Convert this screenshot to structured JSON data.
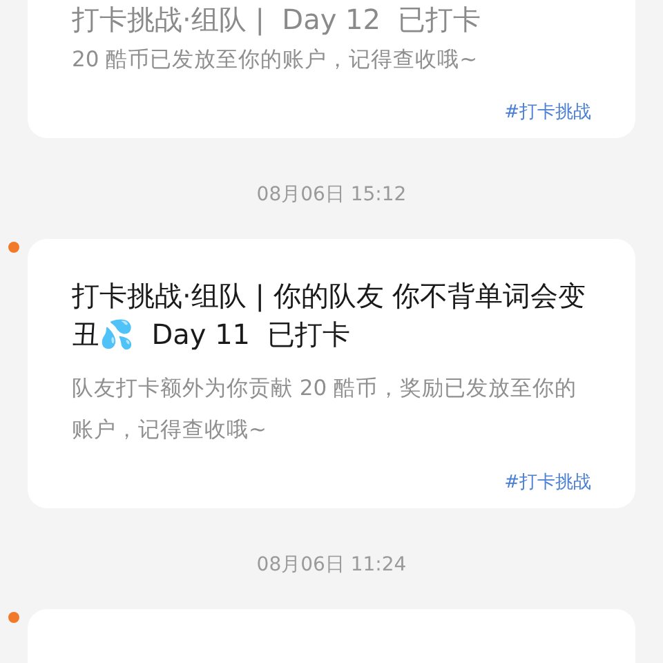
{
  "feed": [
    {
      "kind": "card",
      "unread": false,
      "title": "打卡挑战·组队 |  Day 12  已打卡",
      "body": "20 酷币已发放至你的账户，记得查收哦~",
      "tag": "#打卡挑战"
    },
    {
      "kind": "time",
      "text": "08月06日 15:12"
    },
    {
      "kind": "card",
      "unread": true,
      "title": "打卡挑战·组队 | 你的队友 你不背单词会变丑💦  Day 11  已打卡",
      "body": "队友打卡额外为你贡献 20 酷币，奖励已发放至你的账户，记得查收哦~",
      "tag": "#打卡挑战"
    },
    {
      "kind": "time",
      "text": "08月06日 11:24"
    },
    {
      "kind": "card",
      "unread": true
    }
  ]
}
